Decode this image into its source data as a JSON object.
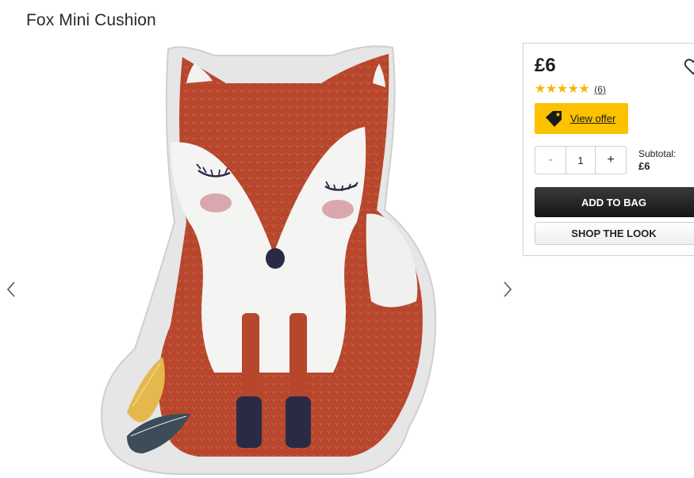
{
  "product": {
    "title": "Fox Mini Cushion"
  },
  "gallery": {
    "image_alt": "Fox Mini Cushion",
    "prev_icon": "chevron-left-icon",
    "next_icon": "chevron-right-icon"
  },
  "buy_panel": {
    "price": "£6",
    "wishlist_icon": "heart-icon",
    "rating": {
      "stars_value": 5,
      "stars_text": "★★★★★",
      "count_label": "(6)"
    },
    "offer": {
      "label": "View offer",
      "icon": "price-tag-icon",
      "color": "#fcc200"
    },
    "quantity": {
      "minus_label": "-",
      "value": "1",
      "plus_label": "+"
    },
    "subtotal": {
      "label": "Subtotal:",
      "value": "£6"
    },
    "add_to_bag_label": "ADD TO BAG",
    "shop_the_look_label": "SHOP THE LOOK"
  },
  "colors": {
    "accent_yellow": "#fcc200",
    "star": "#f6b700",
    "button_dark": "#1f1f1f"
  }
}
